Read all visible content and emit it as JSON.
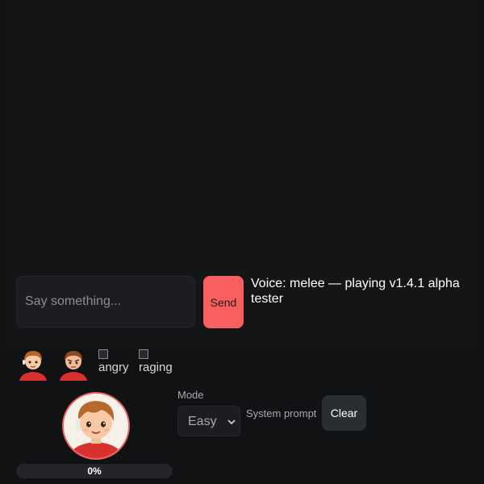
{
  "chat": {
    "placeholder": "Say something...",
    "send_label": "Send"
  },
  "status": {
    "text": "Voice: melee — playing v1.4.1 alpha tester"
  },
  "expressions": {
    "items": [
      {
        "name": "neutral",
        "alt": ""
      },
      {
        "name": "annoyed",
        "alt": ""
      },
      {
        "name": "angry",
        "alt": "angry"
      },
      {
        "name": "raging",
        "alt": "raging"
      }
    ]
  },
  "progress": {
    "value": 0,
    "label": "0%"
  },
  "controls": {
    "mode_label": "Mode",
    "mode_value": "Easy",
    "system_prompt_label": "System prompt",
    "clear_label": "Clear"
  },
  "colors": {
    "accent": "#fa5f60",
    "background": "#111214"
  }
}
